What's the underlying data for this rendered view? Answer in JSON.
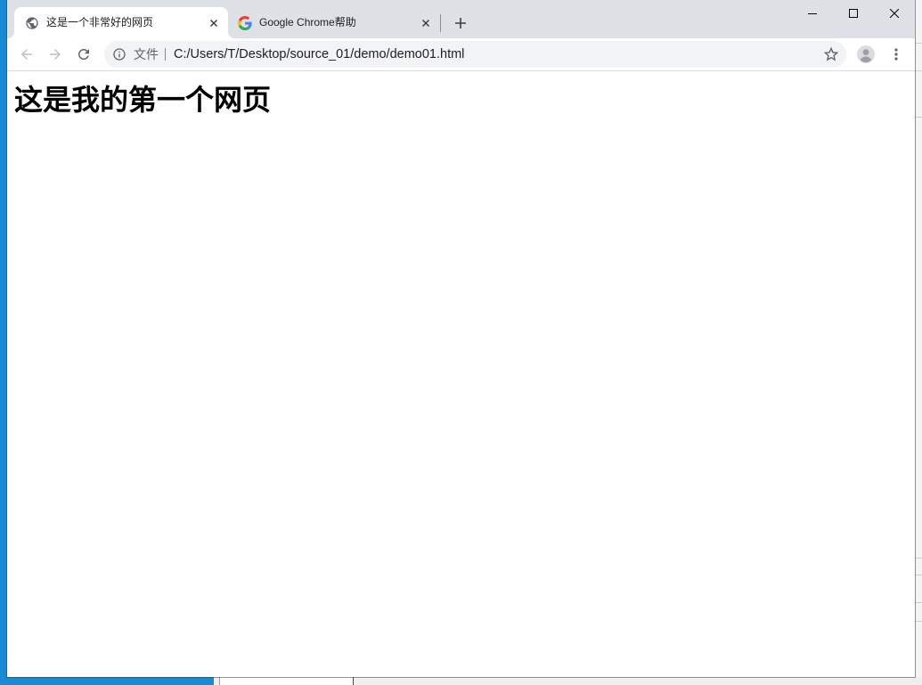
{
  "colors": {
    "desktop_blue": "#1a8ad4",
    "tab_strip": "#dee1e6",
    "active_tab": "#ffffff",
    "omnibox": "#f1f3f4",
    "icon": "#5f6368",
    "icon_disabled": "#bdc1c6",
    "text": "#202124"
  },
  "browser": {
    "tabs": [
      {
        "title": "这是一个非常好的网页",
        "icon": "globe-icon",
        "active": true,
        "close_icon": "close-icon"
      },
      {
        "title": "Google Chrome帮助",
        "icon": "google-g-icon",
        "active": false,
        "close_icon": "close-icon"
      }
    ],
    "new_tab_icon": "plus-icon",
    "window_controls": [
      "minimize-icon",
      "maximize-icon",
      "close-icon"
    ],
    "toolbar": {
      "back_icon": "arrow-back-icon",
      "forward_icon": "arrow-forward-icon",
      "reload_icon": "reload-icon",
      "omnibox": {
        "security_icon": "info-icon",
        "security_label": "文件",
        "url": "C:/Users/T/Desktop/source_01/demo/demo01.html",
        "bookmark_icon": "star-outline-icon"
      },
      "profile_icon": "avatar-icon",
      "menu_icon": "more-vert-icon"
    }
  },
  "page": {
    "heading": "这是我的第一个网页"
  }
}
